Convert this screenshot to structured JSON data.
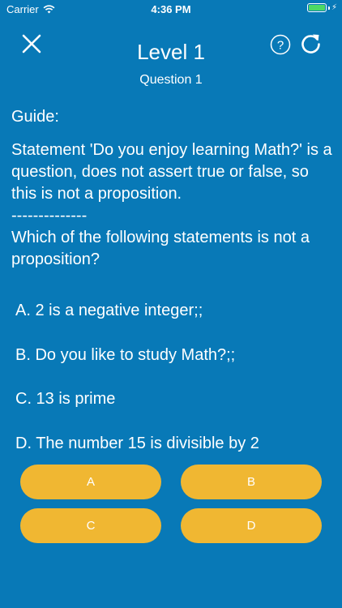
{
  "status_bar": {
    "carrier": "Carrier",
    "time": "4:36 PM",
    "battery_color": "#4cd964"
  },
  "header": {
    "close_icon": "close-icon",
    "title": "Level 1",
    "subtitle": "Question 1",
    "help_icon": "help-circle-icon",
    "refresh_icon": "refresh-icon"
  },
  "content": {
    "guide_label": "Guide:",
    "explanation": "Statement 'Do you enjoy learning Math?' is a question, does not assert true or false, so this is not a proposition.",
    "separator": "--------------",
    "question": "Which of the following statements is not a proposition?",
    "options": [
      "A. 2 is a negative integer;;",
      "B. Do you like to study Math?;;",
      "C. 13 is prime",
      "D. The number 15 is divisible by 2"
    ]
  },
  "answers": {
    "a_label": "A",
    "b_label": "B",
    "c_label": "C",
    "d_label": "D"
  },
  "colors": {
    "background": "#0879b7",
    "button": "#f0b732",
    "text": "#ffffff"
  }
}
